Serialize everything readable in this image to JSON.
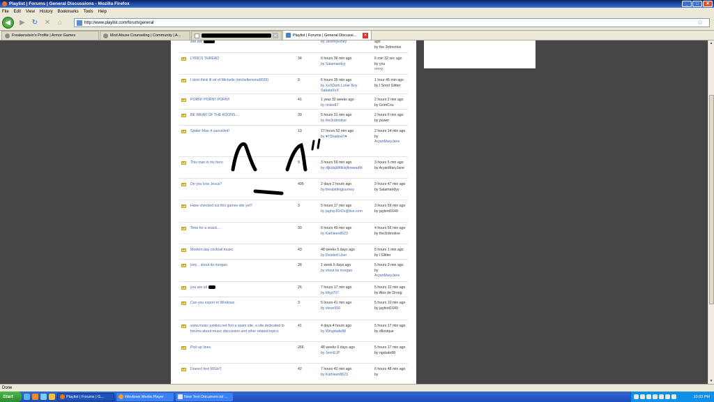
{
  "window": {
    "title": "Playlist | Forums | General Discussions - Mozilla Firefox",
    "min": "_",
    "max": "□",
    "close": "✕"
  },
  "menu": [
    "File",
    "Edit",
    "View",
    "History",
    "Bookmarks",
    "Tools",
    "Help"
  ],
  "address": {
    "url": "http://www.playlist.com/forum/general"
  },
  "tabs": [
    {
      "label": "Freakenstein's Profile | Armor Games",
      "active": false
    },
    {
      "label": "Mod Abuse Counseling | Community | A...",
      "active": false
    },
    {
      "label": "",
      "active": false,
      "redacted": true
    },
    {
      "label": "Playlist | Forums | General Discussi...",
      "active": true
    }
  ],
  "rows": [
    {
      "topic": "see are",
      "count": "",
      "last": "by JeremyRiney",
      "last_time": "",
      "mine": "ago",
      "mine_by": "by the 3rdmotive",
      "partial_top": true
    },
    {
      "topic": "LYRICS THREAD",
      "count": "34",
      "last_time": "6 hours 36 min ago",
      "last": "by Salamandyy",
      "mine": "6 min 32 sec ago",
      "mine_by": "by you",
      "mine_extra": "rexxy"
    },
    {
      "topic": "I dont think ill rid of Michelle (michellemone8026)",
      "count": "9",
      "last_time": "6 hours 35 min ago",
      "last": "by XxXDark Lunar Boy",
      "last_extra": "SabataXxX",
      "mine": "1 hour 45 min ago",
      "mine_by": "by I Snort Glitter"
    },
    {
      "topic": "PORN!! PORN!! PORN!!",
      "count": "41",
      "last_time": "1 year 32 weeks ago",
      "last": "by rinlee87",
      "mine": "2 hours 2 min ago",
      "mine_by": "by GrimCou"
    },
    {
      "topic": "BE WEAR OF THE KOONS....",
      "count": "39",
      "last_time": "5 hours 31 min ago",
      "last": "by the3rdmotive",
      "mine": "2 hours 6 min ago",
      "mine_by": "by power"
    },
    {
      "topic": "Spider-Man 4 cancelled!",
      "count": "13",
      "last_time": "17 hours 52 min ago",
      "last": "by ♥†Shadow†♥",
      "mine": "2 hours 14 min ago",
      "mine_by": "by",
      "mine_extra": "AryanMaryJane"
    },
    {
      "topic": "This man is my hero",
      "count": "9",
      "last_time": "3 hours 59 min ago",
      "last": "by dljkdajldfdklsjfioweadfd",
      "mine": "3 hours 5 min ago",
      "mine_by": "by AryanMaryJane"
    },
    {
      "topic": "Do you love Jesus?",
      "count": "495",
      "last_time": "2 days 2 hours ago",
      "last": "by theabidingjourney",
      "mine": "3 hours 47 min ago",
      "mine_by": "by Salamandyy"
    },
    {
      "topic": "Have checked out this games site yet?",
      "count": "3",
      "last_time": "5 hours 17 min ago",
      "last": "by jaghq-82rl2s@live.com",
      "mine": "3 hours 59 min ago",
      "mine_by": "by jaybird1649"
    },
    {
      "topic": "Time for a snack....",
      "count": "30",
      "last_time": "6 hours 49 min ago",
      "last": "by Kathleen8623",
      "mine": "4 hours 56 min ago",
      "mine_by": "by the3rdmotive"
    },
    {
      "topic": "Modern day cocktail music",
      "count": "43",
      "last_time": "48 weeks 5 days ago",
      "last": "by Deleted User",
      "mine": "5 hours 1 min ago",
      "mine_by": "by I Glitter"
    },
    {
      "topic": "Hey... shout its morgan",
      "count": "28",
      "last_time": "1 week 6 days ago",
      "last": "by shout its morgan",
      "mine": "5 hours 3 min ago",
      "mine_by": "by",
      "mine_extra": "AryanMaryJane"
    },
    {
      "topic": "you are all",
      "count": "26",
      "last_time": "7 hours 17 min ago",
      "last": "by tiltyz707",
      "mine": "5 hours 10 min ago",
      "mine_by": "by Alex de Droog"
    },
    {
      "topic": "Can you export to Windows",
      "count": "3",
      "last_time": "5 hours 41 min ago",
      "last": "by steve550",
      "mine": "5 hours 10 min ago",
      "mine_by": "by jaybird1649"
    },
    {
      "topic": "www.music-junkies.net Not a spam site, a site dedicated to forums about music discussion and other related topics",
      "count": "41",
      "last_time": "4 days 4 hours ago",
      "last": "by Wingdude88",
      "mine": "5 hours 17 min ago",
      "mine_by": "by dllonique"
    },
    {
      "topic": "Pick up lines",
      "count": "266",
      "last_time": "48 weeks 6 days ago",
      "last": "by JennEJP",
      "mine": "5 hours 17 min ago",
      "mine_by": "by ngdude88"
    },
    {
      "topic": "Doesn't feel RIGHT",
      "count": "42",
      "last_time": "7 hours 42 min ago",
      "last": "by Kathleen8623",
      "mine": "6 hours 48 min ago",
      "mine_by": "by"
    }
  ],
  "status": {
    "text": "Done"
  },
  "taskbar": {
    "start": "Start",
    "tasks": [
      {
        "label": "Playlist | Forums | G...",
        "active": true
      },
      {
        "label": "Windows Media Player",
        "active": false
      },
      {
        "label": "New Text Document.txt ...",
        "active": false
      }
    ],
    "clock": "10:03 PM"
  }
}
